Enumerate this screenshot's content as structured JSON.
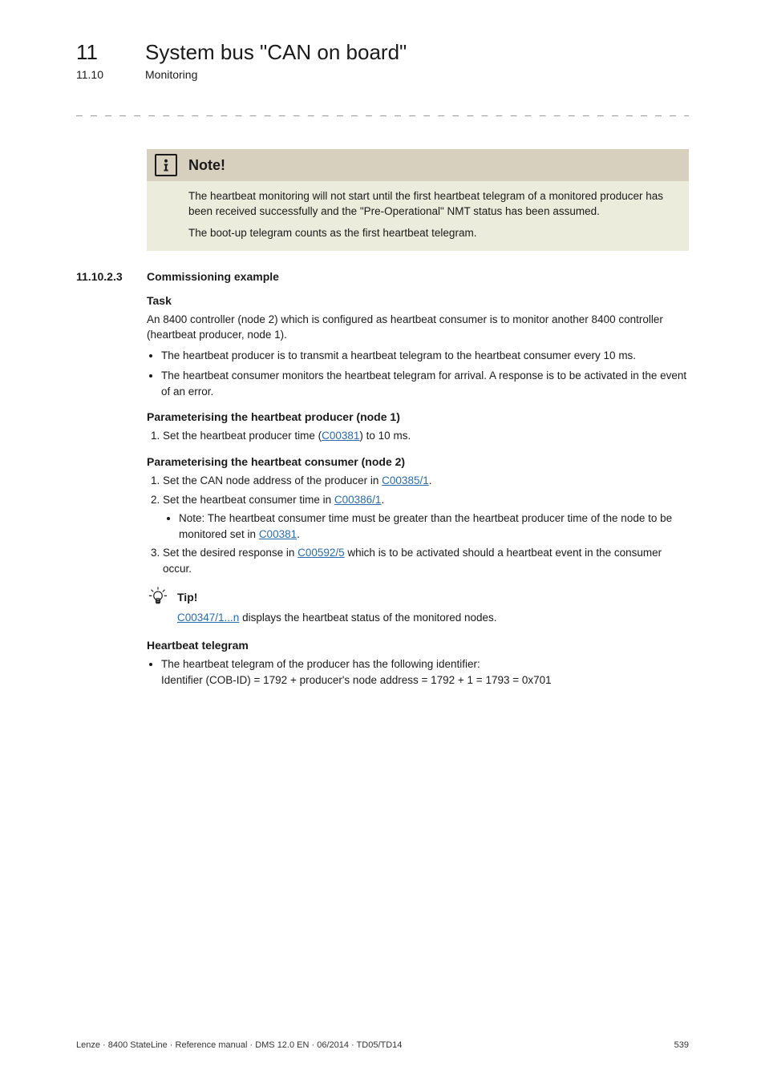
{
  "header": {
    "chapter_num": "11",
    "chapter_title": "System bus \"CAN on board\"",
    "section_num": "11.10",
    "section_title": "Monitoring"
  },
  "dash_rule": "_ _ _ _ _ _ _ _ _ _ _ _ _ _ _ _ _ _ _ _ _ _ _ _ _ _ _ _ _ _ _ _ _ _ _ _ _ _ _ _ _ _ _ _ _ _ _ _ _ _ _ _ _ _ _ _ _ _ _ _ _ _ _ _",
  "note": {
    "title": "Note!",
    "p1": "The heartbeat monitoring will not start until the first heartbeat telegram of a monitored producer has been received successfully and the \"Pre-Operational\" NMT status has been assumed.",
    "p2": "The boot-up telegram counts as the first heartbeat telegram."
  },
  "subsection": {
    "num": "11.10.2.3",
    "title": "Commissioning example"
  },
  "task": {
    "heading": "Task",
    "intro": "An 8400 controller (node 2) which is configured as heartbeat consumer is to monitor another 8400 controller (heartbeat producer, node 1).",
    "b1": "The heartbeat producer is to transmit a heartbeat telegram to the heartbeat consumer every 10 ms.",
    "b2": "The heartbeat consumer monitors the heartbeat telegram for arrival. A response is to be activated in the event of an error."
  },
  "producer": {
    "heading": "Parameterising the heartbeat producer (node 1)",
    "s1_pre": "Set the heartbeat producer time (",
    "s1_link": "C00381",
    "s1_post": ") to 10 ms."
  },
  "consumer": {
    "heading": "Parameterising the heartbeat consumer (node 2)",
    "s1_pre": "Set the CAN node address of the producer in ",
    "s1_link": "C00385/1",
    "s1_post": ".",
    "s2_pre": "Set the heartbeat consumer time in ",
    "s2_link": "C00386/1",
    "s2_post": ".",
    "s2_note_pre": "Note: The heartbeat consumer time must be greater than the heartbeat producer time of the node to be monitored set in ",
    "s2_note_link": "C00381",
    "s2_note_post": ".",
    "s3_pre": "Set the desired response in ",
    "s3_link": "C00592/5",
    "s3_post": " which is to be activated should a heartbeat event in the consumer occur."
  },
  "tip": {
    "label": "Tip!",
    "link": "C00347/1...n",
    "text_post": " displays the heartbeat status of the monitored nodes."
  },
  "telegram": {
    "heading": "Heartbeat telegram",
    "b1_l1": "The heartbeat telegram of the producer has the following identifier:",
    "b1_l2": "Identifier (COB-ID) = 1792 + producer's node address = 1792 + 1 = 1793 = 0x701"
  },
  "footer": {
    "left": "Lenze · 8400 StateLine · Reference manual · DMS 12.0 EN · 06/2014 · TD05/TD14",
    "right": "539"
  }
}
